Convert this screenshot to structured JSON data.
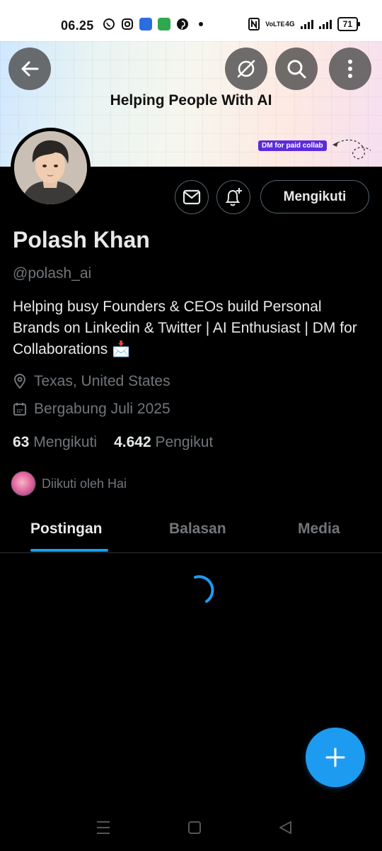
{
  "status_bar": {
    "time": "06.25",
    "battery": "71",
    "network_label": "4G",
    "carrier_label": "VoLTE"
  },
  "banner": {
    "title": "Helping People With AI",
    "tag": "DM for paid collab"
  },
  "profile": {
    "name": "Polash Khan",
    "handle": "@polash_ai",
    "bio": "Helping busy Founders & CEOs build Personal Brands on Linkedin & Twitter | AI Enthusiast | DM for Collaborations 📩",
    "location": "Texas, United States",
    "joined": "Bergabung Juli 2025",
    "following_count": "63",
    "following_label": "Mengikuti",
    "followers_count": "4.642",
    "followers_label": "Pengikut",
    "followed_by": "Diikuti oleh Hai"
  },
  "actions": {
    "follow_label": "Mengikuti"
  },
  "tabs": [
    {
      "label": "Postingan",
      "active": true
    },
    {
      "label": "Balasan",
      "active": false
    },
    {
      "label": "Media",
      "active": false
    }
  ],
  "colors": {
    "accent": "#1d9bf0",
    "background": "#000000",
    "text_primary": "#e7e9ea",
    "text_secondary": "#71767b"
  }
}
